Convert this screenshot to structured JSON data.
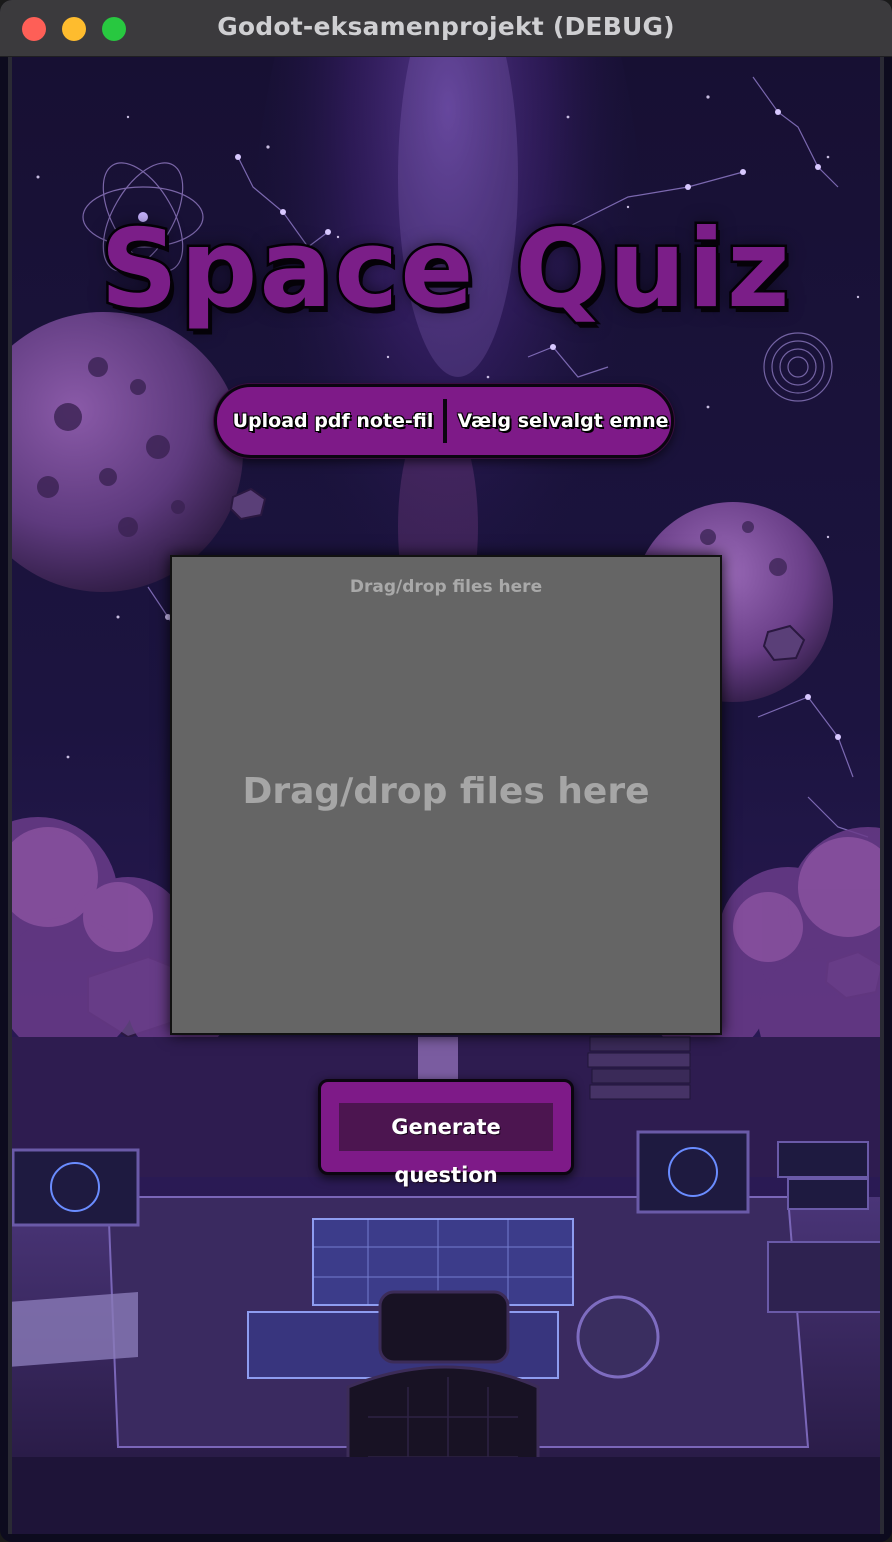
{
  "window": {
    "title": "Godot-eksamenprojekt (DEBUG)"
  },
  "game": {
    "title": "Space Quiz",
    "mode_buttons": {
      "upload": "Upload pdf note-fil",
      "topic": "Vælg selvalgt emne"
    },
    "dropzone": {
      "hint_small": "Drag/drop files here",
      "hint_large": "Drag/drop files here"
    },
    "generate_button": "Generate question"
  },
  "colors": {
    "accent_purple": "#7e1a88",
    "button_inner": "#4c1550",
    "dropzone_gray": "#656565"
  }
}
